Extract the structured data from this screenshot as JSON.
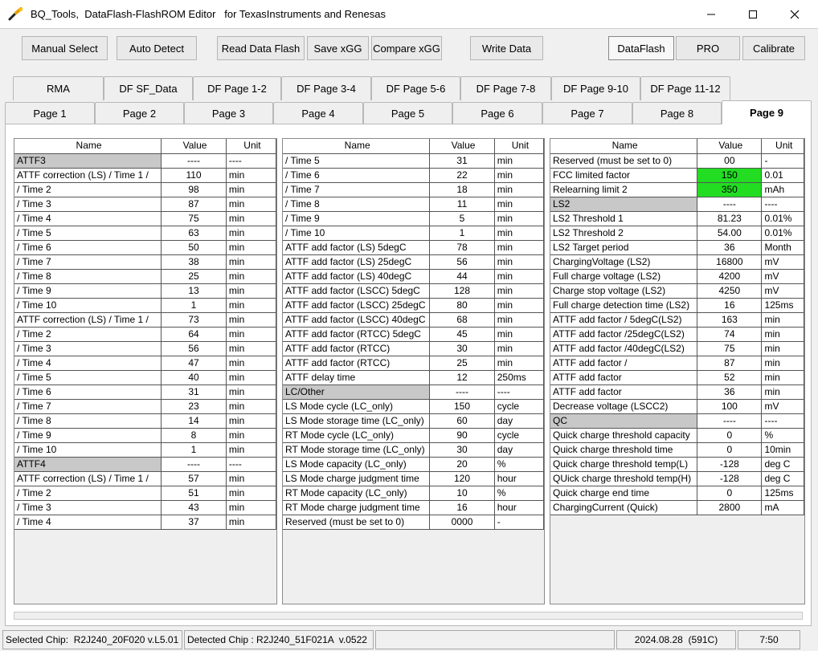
{
  "window": {
    "title": "BQ_Tools,  DataFlash-FlashROM Editor   for TexasInstruments and Renesas",
    "icon": "wrench-icon"
  },
  "toolbar": {
    "manual_select": "Manual Select",
    "auto_detect": "Auto Detect",
    "read_data_flash": "Read Data Flash",
    "save_xgg": "Save xGG",
    "compare_xgg": "Compare xGG",
    "write_data": "Write Data",
    "dataflash": "DataFlash",
    "pro": "PRO",
    "calibrate": "Calibrate"
  },
  "tabs_top": [
    "RMA",
    "DF SF_Data",
    "DF Page 1-2",
    "DF Page 3-4",
    "DF Page 5-6",
    "DF Page 7-8",
    "DF Page 9-10",
    "DF Page 11-12"
  ],
  "tabs_bottom": [
    "Page 1",
    "Page 2",
    "Page 3",
    "Page 4",
    "Page 5",
    "Page 6",
    "Page 7",
    "Page 8",
    "Page 9"
  ],
  "active_tab": "Page 9",
  "grid_headers": {
    "name": "Name",
    "value": "Value",
    "unit": "Unit"
  },
  "grid1": [
    {
      "name": "ATTF3",
      "value": "----",
      "unit": "----",
      "section": true
    },
    {
      "name": "ATTF correction (LS) / Time 1 /",
      "value": "110",
      "unit": "min"
    },
    {
      "name": "/ Time 2",
      "value": "98",
      "unit": "min"
    },
    {
      "name": "/ Time 3",
      "value": "87",
      "unit": "min"
    },
    {
      "name": "/ Time 4",
      "value": "75",
      "unit": "min"
    },
    {
      "name": "/ Time 5",
      "value": "63",
      "unit": "min"
    },
    {
      "name": "/ Time 6",
      "value": "50",
      "unit": "min"
    },
    {
      "name": "/ Time 7",
      "value": "38",
      "unit": "min"
    },
    {
      "name": "/ Time 8",
      "value": "25",
      "unit": "min"
    },
    {
      "name": "/ Time 9",
      "value": "13",
      "unit": "min"
    },
    {
      "name": "/ Time 10",
      "value": "1",
      "unit": "min"
    },
    {
      "name": "ATTF correction (LS) / Time 1 /",
      "value": "73",
      "unit": "min"
    },
    {
      "name": "/ Time 2",
      "value": "64",
      "unit": "min"
    },
    {
      "name": "/ Time 3",
      "value": "56",
      "unit": "min"
    },
    {
      "name": "/ Time 4",
      "value": "47",
      "unit": "min"
    },
    {
      "name": "/ Time 5",
      "value": "40",
      "unit": "min"
    },
    {
      "name": "/ Time 6",
      "value": "31",
      "unit": "min"
    },
    {
      "name": "/ Time 7",
      "value": "23",
      "unit": "min"
    },
    {
      "name": "/ Time 8",
      "value": "14",
      "unit": "min"
    },
    {
      "name": "/ Time 9",
      "value": "8",
      "unit": "min"
    },
    {
      "name": "/ Time 10",
      "value": "1",
      "unit": "min"
    },
    {
      "name": "ATTF4",
      "value": "----",
      "unit": "----",
      "section": true
    },
    {
      "name": "ATTF correction (LS) / Time 1 /",
      "value": "57",
      "unit": "min"
    },
    {
      "name": "/ Time 2",
      "value": "51",
      "unit": "min"
    },
    {
      "name": "/ Time 3",
      "value": "43",
      "unit": "min"
    },
    {
      "name": "/ Time 4",
      "value": "37",
      "unit": "min"
    }
  ],
  "grid2": [
    {
      "name": "/ Time 5",
      "value": "31",
      "unit": "min"
    },
    {
      "name": "/ Time 6",
      "value": "22",
      "unit": "min"
    },
    {
      "name": "/ Time 7",
      "value": "18",
      "unit": "min"
    },
    {
      "name": "/ Time 8",
      "value": "11",
      "unit": "min"
    },
    {
      "name": "/ Time 9",
      "value": "5",
      "unit": "min"
    },
    {
      "name": "/ Time 10",
      "value": "1",
      "unit": "min"
    },
    {
      "name": "ATTF add factor (LS) 5degC",
      "value": "78",
      "unit": "min"
    },
    {
      "name": "ATTF add factor (LS) 25degC",
      "value": "56",
      "unit": "min"
    },
    {
      "name": "ATTF add factor (LS) 40degC",
      "value": "44",
      "unit": "min"
    },
    {
      "name": "ATTF add factor (LSCC) 5degC",
      "value": "128",
      "unit": "min"
    },
    {
      "name": "ATTF add factor (LSCC) 25degC",
      "value": "80",
      "unit": "min"
    },
    {
      "name": "ATTF add factor (LSCC) 40degC",
      "value": "68",
      "unit": "min"
    },
    {
      "name": "ATTF add factor (RTCC) 5degC",
      "value": "45",
      "unit": "min"
    },
    {
      "name": "ATTF add factor (RTCC)",
      "value": "30",
      "unit": "min"
    },
    {
      "name": "ATTF add factor (RTCC)",
      "value": "25",
      "unit": "min"
    },
    {
      "name": "ATTF delay time",
      "value": "12",
      "unit": "250ms"
    },
    {
      "name": "LC/Other",
      "value": "----",
      "unit": "----",
      "section": true
    },
    {
      "name": "LS Mode cycle (LC_only)",
      "value": "150",
      "unit": "cycle"
    },
    {
      "name": "LS Mode storage time (LC_only)",
      "value": "60",
      "unit": "day"
    },
    {
      "name": "RT Mode cycle (LC_only)",
      "value": "90",
      "unit": "cycle"
    },
    {
      "name": "RT Mode storage time (LC_only)",
      "value": "30",
      "unit": "day"
    },
    {
      "name": "LS Mode capacity (LC_only)",
      "value": "20",
      "unit": "%"
    },
    {
      "name": "LS Mode charge judgment time",
      "value": "120",
      "unit": "hour"
    },
    {
      "name": "RT Mode capacity (LC_only)",
      "value": "10",
      "unit": "%"
    },
    {
      "name": "RT Mode charge judgment time",
      "value": "16",
      "unit": "hour"
    },
    {
      "name": "Reserved (must be set to 0)",
      "value": "0000",
      "unit": "-"
    }
  ],
  "grid3": [
    {
      "name": "Reserved (must be set to 0)",
      "value": "00",
      "unit": "-"
    },
    {
      "name": "FCC limited factor",
      "value": "150",
      "unit": "0.01",
      "highlight": true
    },
    {
      "name": "Relearning limit 2",
      "value": "350",
      "unit": "mAh",
      "highlight": true
    },
    {
      "name": "LS2",
      "value": "----",
      "unit": "----",
      "section": true
    },
    {
      "name": "LS2 Threshold 1",
      "value": "81.23",
      "unit": "0.01%"
    },
    {
      "name": "LS2 Threshold 2",
      "value": "54.00",
      "unit": "0.01%"
    },
    {
      "name": "LS2 Target period",
      "value": "36",
      "unit": "Month"
    },
    {
      "name": "ChargingVoltage (LS2)",
      "value": "16800",
      "unit": "mV"
    },
    {
      "name": "Full charge voltage (LS2)",
      "value": "4200",
      "unit": "mV"
    },
    {
      "name": "Charge stop voltage (LS2)",
      "value": "4250",
      "unit": "mV"
    },
    {
      "name": "Full charge detection time (LS2)",
      "value": "16",
      "unit": "125ms"
    },
    {
      "name": "ATTF add factor / 5degC(LS2)",
      "value": "163",
      "unit": "min"
    },
    {
      "name": "ATTF add factor /25degC(LS2)",
      "value": "74",
      "unit": "min"
    },
    {
      "name": "ATTF add factor /40degC(LS2)",
      "value": "75",
      "unit": "min"
    },
    {
      "name": "ATTF add factor /",
      "value": "87",
      "unit": "min"
    },
    {
      "name": "ATTF add factor",
      "value": "52",
      "unit": "min"
    },
    {
      "name": "ATTF add factor",
      "value": "36",
      "unit": "min"
    },
    {
      "name": "Decrease voltage (LSCC2)",
      "value": "100",
      "unit": "mV"
    },
    {
      "name": "QC",
      "value": "----",
      "unit": "----",
      "section": true
    },
    {
      "name": "Quick charge threshold capacity",
      "value": "0",
      "unit": "%"
    },
    {
      "name": "Quick charge threshold time",
      "value": "0",
      "unit": "10min"
    },
    {
      "name": "Quick charge threshold temp(L)",
      "value": "-128",
      "unit": "deg C"
    },
    {
      "name": "QUick charge threshold temp(H)",
      "value": "-128",
      "unit": "deg C"
    },
    {
      "name": "Quick charge end time",
      "value": "0",
      "unit": "125ms"
    },
    {
      "name": "ChargingCurrent (Quick)",
      "value": "2800",
      "unit": "mA"
    }
  ],
  "status": {
    "selected_chip": "Selected Chip:  R2J240_20F020 v.L5.01",
    "detected_chip": "Detected Chip : R2J240_51F021A  v.0522",
    "date": "2024.08.28  (591C)",
    "time": "7:50"
  },
  "colors": {
    "highlight": "#22dd22",
    "section": "#c8c8c8"
  }
}
